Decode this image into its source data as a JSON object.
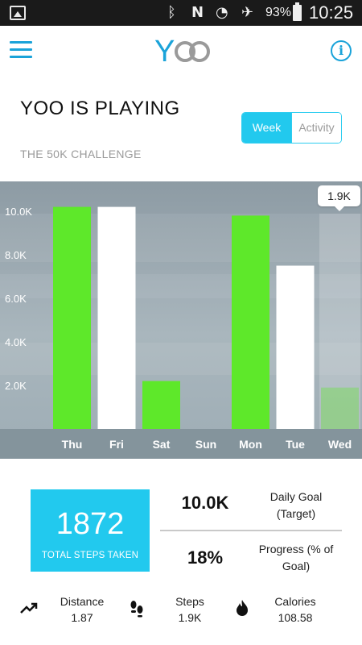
{
  "status_bar": {
    "battery_percent": "93%",
    "time": "10:25",
    "icons": [
      "image-icon",
      "bluetooth-icon",
      "nfc-icon",
      "wifi-icon",
      "airplane-icon",
      "battery-icon"
    ]
  },
  "app_bar": {
    "logo_text": "Yoo",
    "info_label": "i"
  },
  "header": {
    "title": "YOO IS PLAYING",
    "subtitle": "THE 50K CHALLENGE"
  },
  "toggle": {
    "week_label": "Week",
    "activity_label": "Activity",
    "selected": "Week"
  },
  "chart_data": {
    "type": "bar",
    "categories": [
      "Thu",
      "Fri",
      "Sat",
      "Sun",
      "Mon",
      "Tue",
      "Wed"
    ],
    "values": [
      10.2,
      10.2,
      2.2,
      0,
      9.8,
      7.5,
      1.9
    ],
    "bar_colors": [
      "#5ee82a",
      "#ffffff",
      "#5ee82a",
      "#ffffff",
      "#5ee82a",
      "#ffffff",
      "#5ee82a"
    ],
    "y_ticks": [
      "2.0K",
      "4.0K",
      "6.0K",
      "8.0K",
      "10.0K"
    ],
    "ylim": [
      0,
      11.0
    ],
    "selected_category": "Wed",
    "tooltip": "1.9K"
  },
  "stats": {
    "total_steps": "1872",
    "total_steps_label": "TOTAL STEPS TAKEN",
    "daily_goal_value": "10.0K",
    "daily_goal_label": "Daily Goal (Target)",
    "progress_value": "18%",
    "progress_label": "Progress (% of Goal)"
  },
  "bottom": {
    "distance_label": "Distance",
    "distance_value": "1.87",
    "steps_label": "Steps",
    "steps_value": "1.9K",
    "calories_label": "Calories",
    "calories_value": "108.58"
  },
  "colors": {
    "accent": "#22c9ee",
    "bar_green": "#5ee82a",
    "bar_white": "#ffffff"
  }
}
